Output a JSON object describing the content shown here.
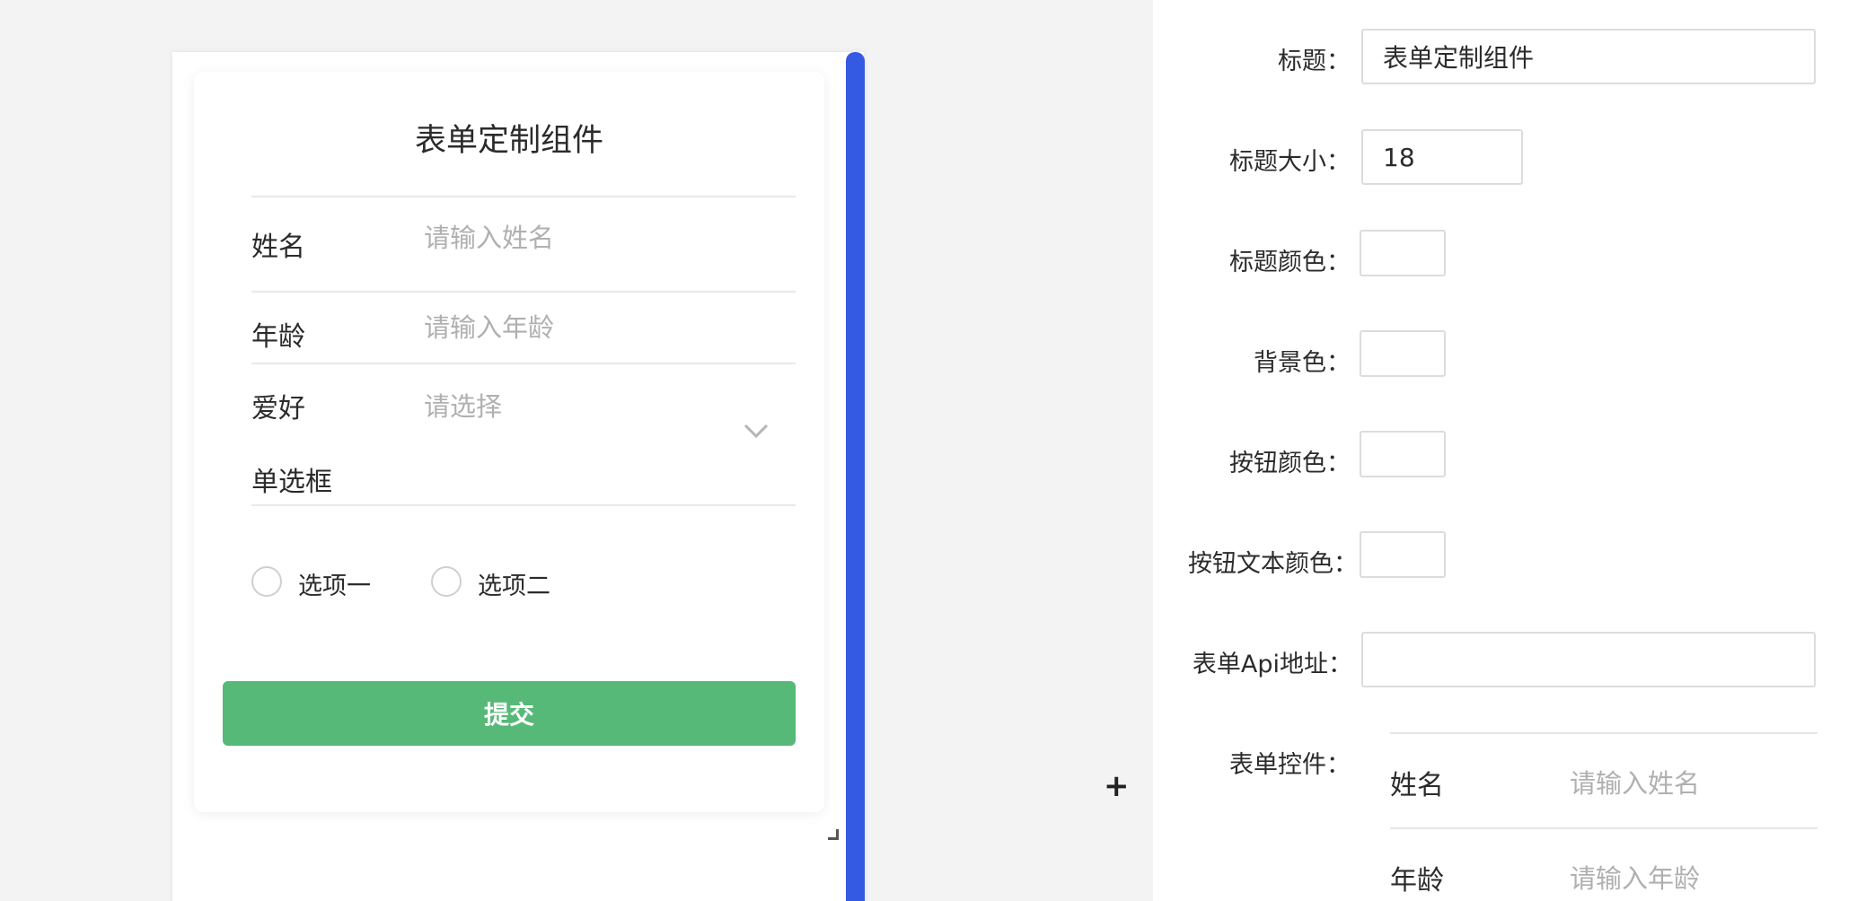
{
  "canvas": {
    "title": "表单定制组件",
    "fields": [
      {
        "label": "姓名",
        "placeholder": "请输入姓名"
      },
      {
        "label": "年龄",
        "placeholder": "请输入年龄"
      }
    ],
    "select": {
      "label": "爱好",
      "placeholder": "请选择"
    },
    "radio_group": {
      "label": "单选框",
      "options": [
        "选项一",
        "选项二"
      ]
    },
    "submit_label": "提交",
    "plus": "+"
  },
  "panel": {
    "title_label": "标题：",
    "title_value": "表单定制组件",
    "title_size_label": "标题大小：",
    "title_size_value": "18",
    "title_color_label": "标题颜色：",
    "bg_color_label": "背景色：",
    "btn_color_label": "按钮颜色：",
    "btn_text_color_label": "按钮文本颜色：",
    "api_label": "表单Api地址：",
    "api_value": "",
    "controls_label": "表单控件：",
    "controls": [
      {
        "label": "姓名",
        "placeholder": "请输入姓名"
      },
      {
        "label": "年龄",
        "placeholder": "请输入年龄"
      }
    ]
  },
  "colors": {
    "accent_blue": "#3459e2",
    "submit_green": "#56b978"
  }
}
